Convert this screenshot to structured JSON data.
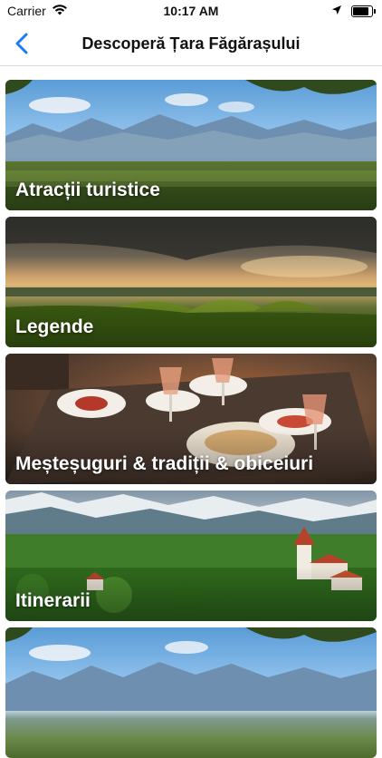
{
  "status_bar": {
    "carrier": "Carrier",
    "time": "10:17 AM",
    "battery_level": 0.9
  },
  "nav": {
    "title": "Descoperă Țara Făgărașului",
    "back_icon": "chevron-left-icon",
    "accent_color": "#1a7cf5"
  },
  "categories": [
    {
      "label": "Atracții turistice"
    },
    {
      "label": "Legende"
    },
    {
      "label": "Meșteșuguri & tradiții & obiceiuri"
    },
    {
      "label": "Itinerarii"
    },
    {
      "label": ""
    }
  ]
}
